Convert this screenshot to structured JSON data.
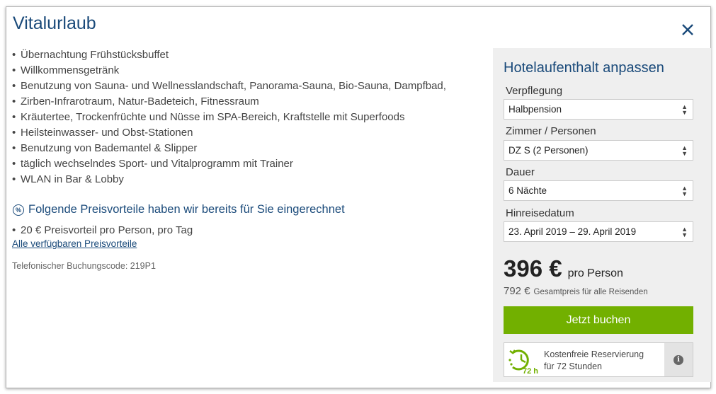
{
  "modal": {
    "title": "Vitalurlaub",
    "close_icon": "close-icon"
  },
  "features": [
    "Übernachtung Frühstücksbuffet",
    "Willkommensgetränk",
    "Benutzung von Sauna- und Wellnesslandschaft, Panorama-Sauna, Bio-Sauna, Dampfbad,",
    "Zirben-Infrarotraum, Natur-Badeteich, Fitnessraum",
    "Kräutertee, Trockenfrüchte und Nüsse im SPA-Bereich, Kraftstelle mit Superfoods",
    "Heilsteinwasser- und Obst-Stationen",
    "Benutzung von Bademantel & Slipper",
    "täglich wechselndes Sport- und Vitalprogramm mit Trainer",
    "WLAN in Bar & Lobby"
  ],
  "advantages": {
    "heading": "Folgende Preisvorteile haben wir bereits für Sie eingerechnet",
    "icon": "percent-icon",
    "items": [
      "20 € Preisvorteil pro Person, pro Tag"
    ],
    "link": "Alle verfügbaren Preisvorteile"
  },
  "booking_code": "Telefonischer Buchungscode: 219P1",
  "panel": {
    "title": "Hotelaufenthalt anpassen",
    "fields": [
      {
        "label": "Verpflegung",
        "value": "Halbpension"
      },
      {
        "label": "Zimmer / Personen",
        "value": "DZ S (2 Personen)"
      },
      {
        "label": "Dauer",
        "value": "6 Nächte"
      },
      {
        "label": "Hinreisedatum",
        "value": "23. April 2019 – 29. April 2019"
      }
    ],
    "price": "396 €",
    "price_unit": "pro Person",
    "total_amount": "792 €",
    "total_note": "Gesamtpreis für alle Reisenden",
    "book_button": "Jetzt buchen",
    "reservation": {
      "icon": "clock-72h-icon",
      "icon_label": "72 h",
      "line1": "Kostenfreie Reservierung",
      "line2": "für 72 Stunden",
      "info_icon": "info-icon"
    }
  },
  "colors": {
    "accent": "#1a4a7a",
    "book_button": "#72b000",
    "panel_bg": "#efefef"
  }
}
